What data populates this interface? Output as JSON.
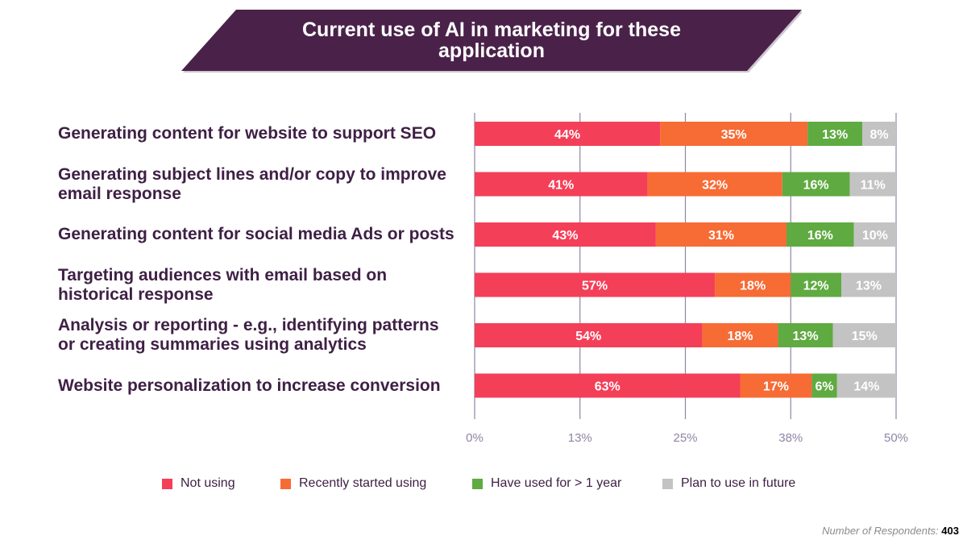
{
  "title": {
    "line1": "Current use of AI in marketing for these",
    "line2": "application",
    "background": "#4a2249"
  },
  "chart_data": {
    "type": "bar",
    "orientation": "horizontal",
    "stacked": true,
    "title": "Current use of AI in marketing for these application",
    "xlabel": "",
    "ylabel": "",
    "categories": [
      "Generating content for website to support SEO",
      "Generating subject lines and/or copy to improve email response",
      "Generating content for social media Ads or posts",
      "Targeting audiences with email based on historical response",
      "Analysis or reporting - e.g., identifying patterns or creating summaries using analytics",
      "Website personalization to increase conversion"
    ],
    "category_lines": [
      [
        "Generating content for website to support SEO"
      ],
      [
        "Generating subject lines and/or copy to improve",
        "email response"
      ],
      [
        "Generating content for social media Ads or posts"
      ],
      [
        "Targeting audiences with email based on",
        "historical response"
      ],
      [
        "Analysis or reporting - e.g., identifying patterns",
        "or creating summaries using analytics"
      ],
      [
        "Website personalization to increase conversion"
      ]
    ],
    "series": [
      {
        "name": "Not using",
        "color": "#f43f58",
        "values": [
          44,
          41,
          43,
          57,
          54,
          63
        ]
      },
      {
        "name": "Recently started using",
        "color": "#f76b35",
        "values": [
          35,
          32,
          31,
          18,
          18,
          17
        ]
      },
      {
        "name": "Have used for > 1 year",
        "color": "#5faa41",
        "values": [
          13,
          16,
          16,
          12,
          13,
          6
        ]
      },
      {
        "name": "Plan to use in future",
        "color": "#c3c3c3",
        "values": [
          8,
          11,
          10,
          13,
          15,
          14
        ]
      }
    ],
    "x_tick_labels": [
      "0%",
      "13%",
      "25%",
      "38%",
      "50%"
    ],
    "xlim": [
      0,
      100
    ],
    "value_suffix": "%",
    "grid": true,
    "legend_position": "bottom"
  },
  "footer": {
    "label": "Number of Respondents:",
    "value": "403"
  }
}
